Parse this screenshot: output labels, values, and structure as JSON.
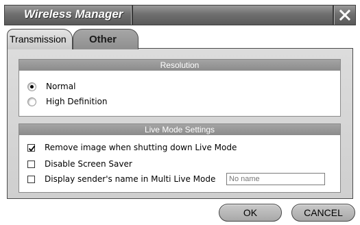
{
  "window": {
    "title": "Wireless Manager"
  },
  "tabs": [
    {
      "label": "Transmission",
      "selected": true
    },
    {
      "label": "Other",
      "selected": false
    }
  ],
  "resolution": {
    "header": "Resolution",
    "options": [
      {
        "label": "Normal",
        "selected": true
      },
      {
        "label": "High Definition",
        "selected": false
      }
    ]
  },
  "live_mode": {
    "header": "Live Mode Settings",
    "options": [
      {
        "label": "Remove image when shutting down Live Mode",
        "checked": true
      },
      {
        "label": "Disable Screen Saver",
        "checked": false
      },
      {
        "label": "Display sender's name in Multi Live Mode",
        "checked": false
      }
    ],
    "name_field": {
      "value": "No name"
    }
  },
  "buttons": {
    "ok": "OK",
    "cancel": "CANCEL"
  },
  "icons": {
    "close": "close-icon",
    "check": "check-icon"
  },
  "colors": {
    "titlebar": "#6f6f6f",
    "panel": "#d6d6d6",
    "group_header": "#999999"
  }
}
